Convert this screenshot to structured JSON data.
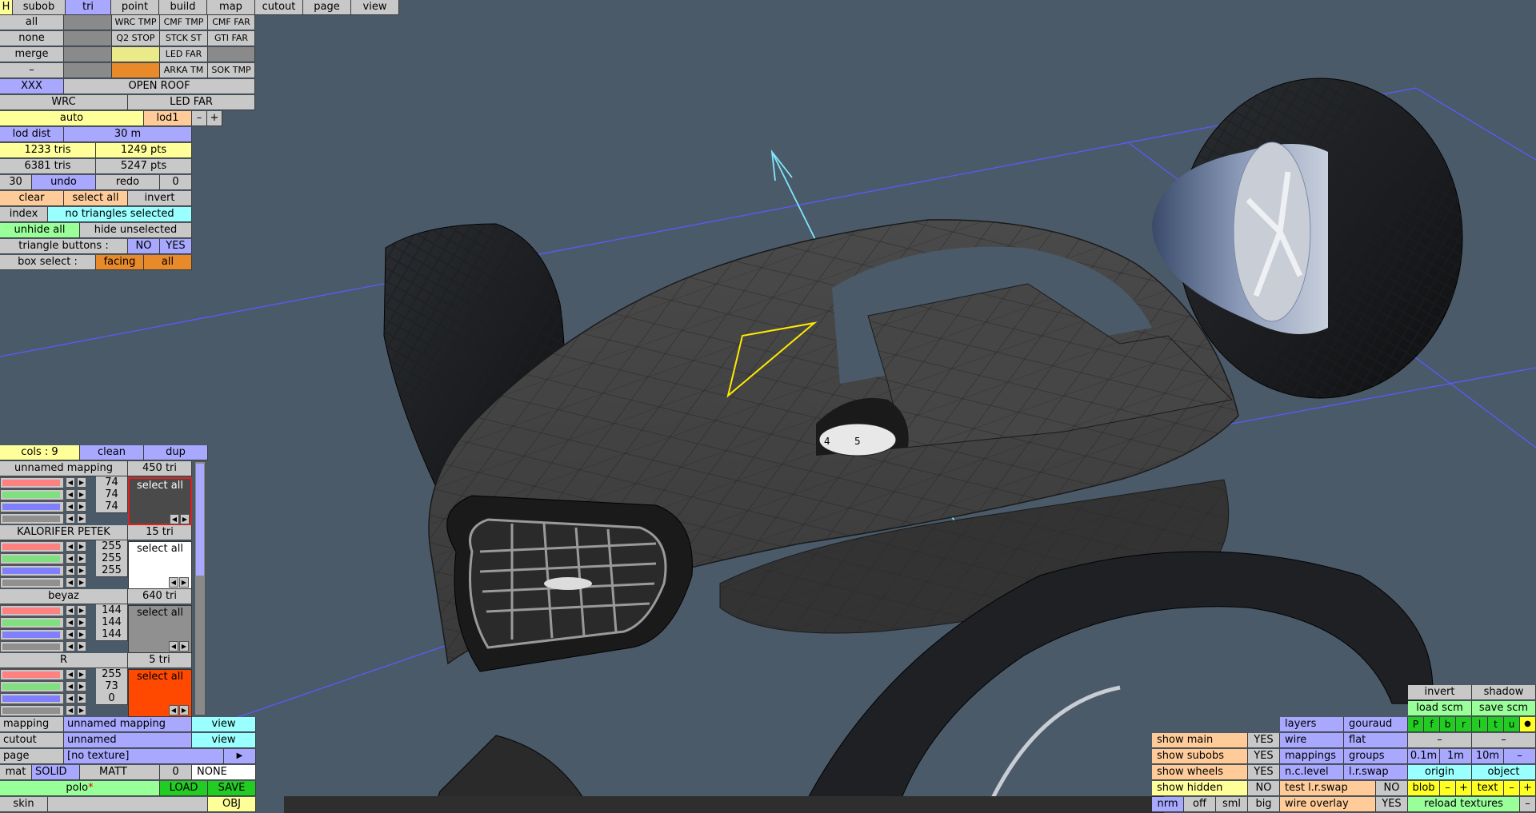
{
  "top_tabs": [
    "H",
    "subob",
    "tri",
    "point",
    "build",
    "map",
    "cutout",
    "page",
    "view"
  ],
  "tools": {
    "all": "all",
    "none": "none",
    "merge": "merge",
    "dash": "–",
    "xxx": "XXX",
    "open_roof": "OPEN ROOF",
    "wrc": "WRC",
    "led_far_wide": "LED FAR",
    "auto": "auto",
    "lod1": "lod1",
    "minus": "–",
    "plus": "+"
  },
  "subobjects": [
    "WRC TMP",
    "CMF TMP",
    "CMF FAR",
    "Q2 STOP",
    "STCK ST",
    "GTI FAR",
    "LED FAR",
    "ARKA TM",
    "SOK TMP"
  ],
  "stats": {
    "lod_dist_label": "lod dist",
    "lod_dist_value": "30 m",
    "tris_a": "1233 tris",
    "pts_a": "1249 pts",
    "tris_b": "6381 tris",
    "pts_b": "5247 pts",
    "undo_count": "30",
    "undo": "undo",
    "redo": "redo",
    "redo_count": "0"
  },
  "selection": {
    "clear": "clear",
    "select_all": "select all",
    "invert": "invert",
    "index": "index",
    "no_sel": "no triangles selected",
    "unhide_all": "unhide all",
    "hide_unselected": "hide unselected",
    "tri_buttons": "triangle buttons :",
    "no": "NO",
    "yes": "YES",
    "box_select": "box select :",
    "facing": "facing",
    "all": "all"
  },
  "colors_panel": {
    "cols": "cols : 9",
    "clean": "clean",
    "dup": "dup",
    "materials": [
      {
        "name": "unnamed mapping",
        "tri": "450 tri",
        "r": "74",
        "g": "74",
        "b": "74",
        "swatch": "#4a4a4a",
        "sel": "select all",
        "seltext": "#ffffff"
      },
      {
        "name": "KALORIFER PETEK",
        "tri": "15 tri",
        "r": "255",
        "g": "255",
        "b": "255",
        "swatch": "#ffffff",
        "sel": "select all",
        "seltext": "#000000"
      },
      {
        "name": "beyaz",
        "tri": "640 tri",
        "r": "144",
        "g": "144",
        "b": "144",
        "swatch": "#909090",
        "sel": "select all",
        "seltext": "#000000"
      },
      {
        "name": "R",
        "tri": "5 tri",
        "r": "255",
        "g": "73",
        "b": "0",
        "swatch": "#ff4900",
        "sel": "select all",
        "seltext": "#000000"
      }
    ]
  },
  "bottom_left": {
    "mapping": "mapping",
    "mapping_val": "unnamed mapping",
    "view": "view",
    "cutout": "cutout",
    "cutout_val": "unnamed",
    "page": "page",
    "page_val": "[no texture]",
    "page_arrow": "▶",
    "mat": "mat",
    "solid": "SOLID",
    "matt": "MATT",
    "zero": "0",
    "none": "NONE",
    "polo": "polo",
    "star": "*",
    "load": "LOAD",
    "save": "SAVE",
    "skin": "skin",
    "obj": "OBJ"
  },
  "bottom_right": {
    "show_main": "show main",
    "show_subobs": "show subobs",
    "show_wheels": "show wheels",
    "show_hidden": "show hidden",
    "yes": "YES",
    "no": "NO",
    "nrm": "nrm",
    "off": "off",
    "sml": "sml",
    "big": "big",
    "layers": "layers",
    "gouraud": "gouraud",
    "wire": "wire",
    "flat": "flat",
    "mappings": "mappings",
    "groups": "groups",
    "nc_level": "n.c.level",
    "lr_swap": "l.r.swap",
    "test_lr_swap": "test l.r.swap",
    "wire_overlay": "wire overlay",
    "invert": "invert",
    "shadow": "shadow",
    "load_scm": "load scm",
    "save_scm": "save scm",
    "pfbrltu": [
      "P",
      "f",
      "b",
      "r",
      "l",
      "t",
      "u"
    ],
    "dot": "●",
    "dash": "–",
    "d01": "0.1m",
    "d1": "1m",
    "d10": "10m",
    "origin": "origin",
    "object": "object",
    "blob": "blob",
    "text": "text",
    "minus": "–",
    "plus": "+",
    "reload_textures": "reload textures"
  },
  "viewport": {
    "dial_4": "4",
    "dial_5": "5"
  }
}
